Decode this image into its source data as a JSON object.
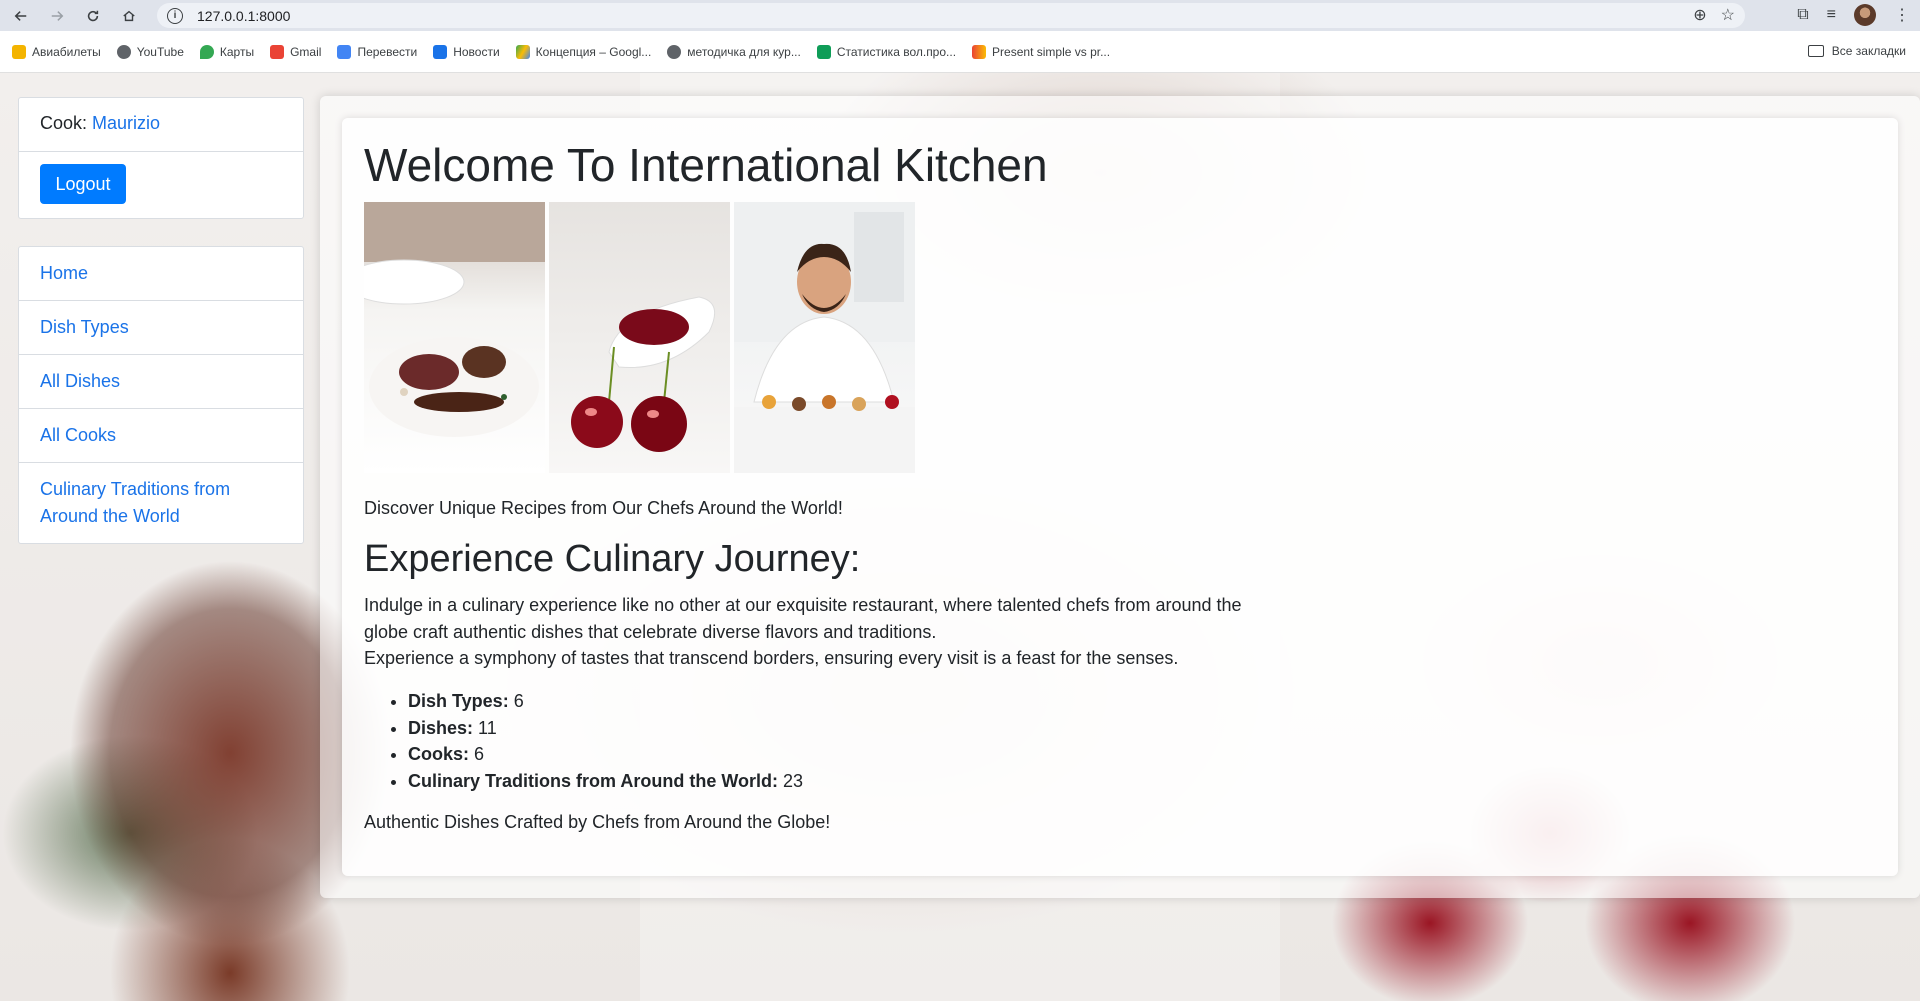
{
  "browser": {
    "url": "127.0.0.1:8000",
    "bookmarks": [
      "Авиабилеты",
      "YouTube",
      "Карты",
      "Gmail",
      "Перевести",
      "Новости",
      "Концепция – Googl...",
      "методичка для кур...",
      "Статистика вол.про...",
      "Present simple vs pr..."
    ],
    "all_bookmarks": "Все закладки"
  },
  "user": {
    "prefix": "Cook: ",
    "name": "Maurizio",
    "logout_label": "Logout"
  },
  "nav": {
    "home": "Home",
    "dish_types": "Dish Types",
    "all_dishes": "All Dishes",
    "all_cooks": "All Cooks",
    "traditions": "Culinary Traditions from Around the World"
  },
  "main": {
    "title": "Welcome To International Kitchen",
    "discover": "Discover Unique Recipes from Our Chefs Around the World!",
    "subtitle": "Experience Culinary Journey:",
    "paragraph_1": "Indulge in a culinary experience like no other at our exquisite restaurant, where talented chefs from around the globe craft authentic dishes that celebrate diverse flavors and traditions.",
    "paragraph_2": "Experience a symphony of tastes that transcend borders, ensuring every visit is a feast for the senses.",
    "stats": [
      {
        "label": "Dish Types:",
        "value": "6"
      },
      {
        "label": "Dishes:",
        "value": "11"
      },
      {
        "label": "Cooks:",
        "value": "6"
      },
      {
        "label": "Culinary Traditions from Around the World:",
        "value": "23"
      }
    ],
    "footer": "Authentic Dishes Crafted by Chefs from Around the Globe!"
  }
}
